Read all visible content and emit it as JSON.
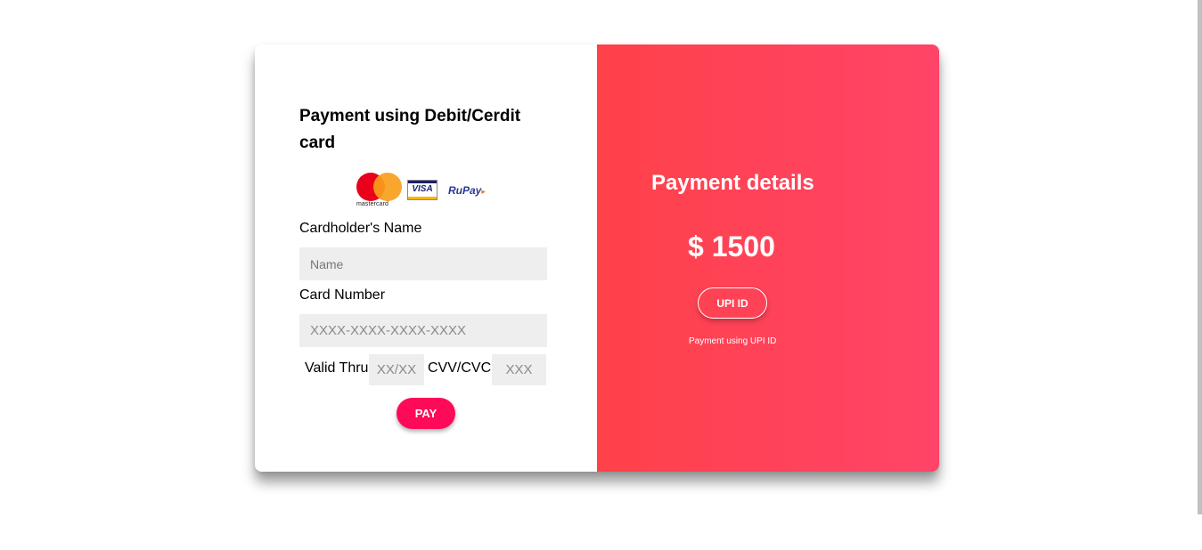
{
  "card_form": {
    "title": "Payment using Debit/Cerdit card",
    "brands": {
      "mastercard": "mastercard",
      "visa": "VISA",
      "rupay": "RuPay"
    },
    "cardholder_label": "Cardholder's Name",
    "name_placeholder": "Name",
    "card_number_label": "Card Number",
    "card_number_placeholder": "XXXX-XXXX-XXXX-XXXX",
    "valid_thru_label": "Valid Thru",
    "valid_thru_placeholder": "XX/XX",
    "cvv_label": "CVV/CVC",
    "cvv_placeholder": "XXX",
    "pay_label": "PAY"
  },
  "details": {
    "title": "Payment details",
    "amount": "$ 1500",
    "upi_button_label": "UPI ID",
    "upi_note": "Payment using UPI ID"
  },
  "colors": {
    "accent_gradient_start": "#ff4149",
    "accent_gradient_end": "#ff4468",
    "pay_button": "#ff0a58",
    "input_bg": "#eeeeee"
  }
}
